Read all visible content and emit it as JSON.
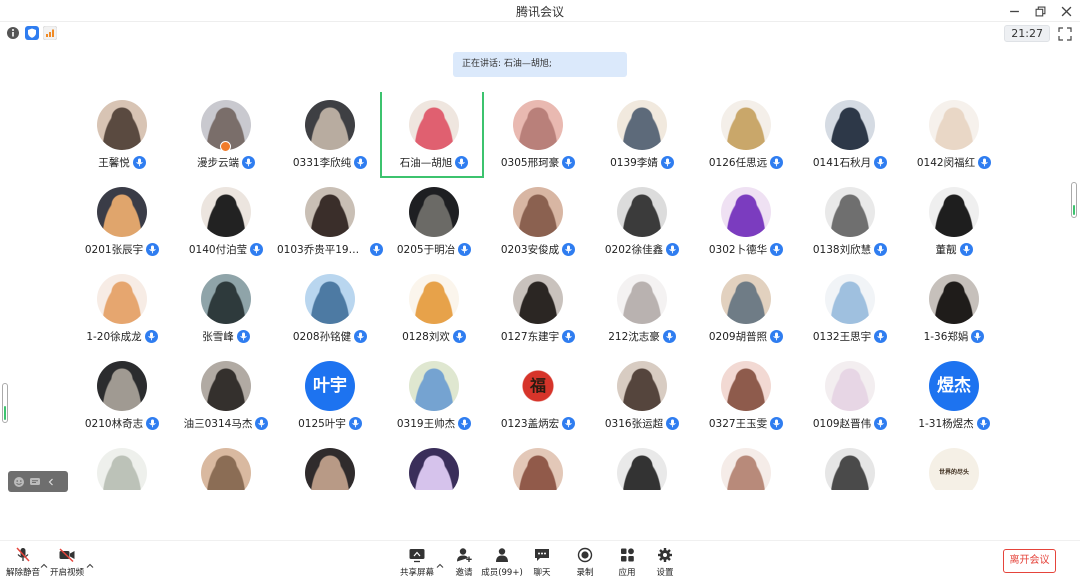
{
  "window": {
    "title": "腾讯会议"
  },
  "status": {
    "clock": "21:27"
  },
  "speaking": {
    "prefix": "正在讲话: ",
    "name": "石油—胡旭;"
  },
  "participants": [
    {
      "name": "王馨悦"
    },
    {
      "name": "漫步云端"
    },
    {
      "name": "0331李欣纯"
    },
    {
      "name": "石油—胡旭"
    },
    {
      "name": "0305邢珂豪"
    },
    {
      "name": "0139李婧"
    },
    {
      "name": "0126任思远"
    },
    {
      "name": "0141石秋月"
    },
    {
      "name": "0142闵福红"
    },
    {
      "name": "0201张辰宇"
    },
    {
      "name": "0140付泊莹"
    },
    {
      "name": "0103乔贵平19油..."
    },
    {
      "name": "0205于明冶"
    },
    {
      "name": "0203安俊成"
    },
    {
      "name": "0202徐佳鑫"
    },
    {
      "name": "0302卜德华"
    },
    {
      "name": "0138刘欣慧"
    },
    {
      "name": "董靓"
    },
    {
      "name": "1-20徐成龙"
    },
    {
      "name": "张雪峰"
    },
    {
      "name": "0208孙铭健"
    },
    {
      "name": "0128刘欢"
    },
    {
      "name": "0127东建宇"
    },
    {
      "name": "212沈志豪"
    },
    {
      "name": "0209胡普照"
    },
    {
      "name": "0132王思宇"
    },
    {
      "name": "1-36郑娟"
    },
    {
      "name": "0210林奇志"
    },
    {
      "name": "油三0314马杰"
    },
    {
      "name": "0125叶宇",
      "avatar_text": "叶宇"
    },
    {
      "name": "0319王帅杰"
    },
    {
      "name": "0123盖炳宏",
      "avatar_text": "福"
    },
    {
      "name": "0316张运超"
    },
    {
      "name": "0327王玉雯"
    },
    {
      "name": "0109赵晋伟"
    },
    {
      "name": "1-31杨煜杰",
      "avatar_text": "煜杰"
    },
    {
      "name": ""
    },
    {
      "name": ""
    },
    {
      "name": ""
    },
    {
      "name": ""
    },
    {
      "name": ""
    },
    {
      "name": ""
    },
    {
      "name": ""
    },
    {
      "name": ""
    },
    {
      "name": "",
      "avatar_text": "世界的尽头"
    }
  ],
  "toolbar": {
    "mute": "解除静音",
    "video": "开启视频",
    "share": "共享屏幕",
    "invite": "邀请",
    "members": "成员(99+)",
    "chat": "聊天",
    "record": "录制",
    "apps": "应用",
    "settings": "设置",
    "leave": "离开会议"
  },
  "colors": {
    "accent": "#2f7df0",
    "active_border": "#3cc36e",
    "leave": "#e5443b",
    "banner": "#dbe9fb"
  }
}
